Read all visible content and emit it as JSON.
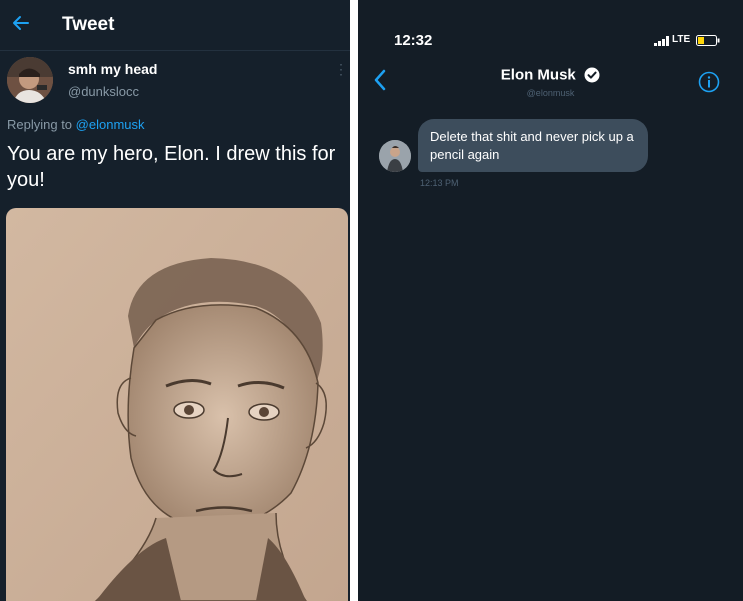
{
  "left": {
    "header": {
      "title": "Tweet"
    },
    "tweet": {
      "author_name": "smh my head",
      "author_handle": "@dunkslocc",
      "replying_prefix": "Replying to",
      "replying_to": "@elonmusk",
      "text": "You are my hero, Elon. I drew this for you!"
    }
  },
  "right": {
    "status_bar": {
      "time": "12:32",
      "network": "LTE"
    },
    "conversation": {
      "name": "Elon Musk",
      "handle": "@elonmusk",
      "message": {
        "text": "Delete that shit and never pick up a pencil again",
        "time": "12:13 PM"
      }
    }
  },
  "colors": {
    "accent": "#1da1f2",
    "tweet_bg": "#15202b",
    "dm_bg": "#141d26",
    "bubble": "#3d4d5c",
    "muted": "#8899a6"
  }
}
